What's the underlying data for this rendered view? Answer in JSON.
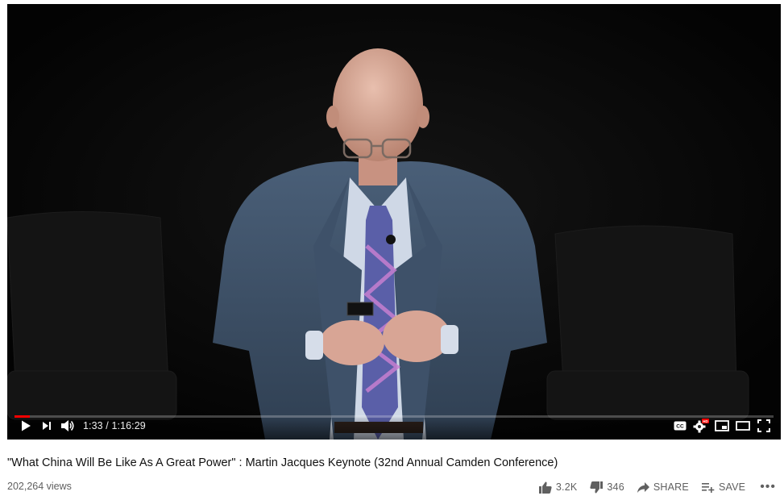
{
  "player": {
    "time": "1:33 / 1:16:29",
    "progress": 0.02,
    "progress_color": "#ff0000",
    "controls": [
      "play-icon",
      "next-icon",
      "volume-icon",
      "subtitles-icon",
      "settings-icon",
      "miniplayer-icon",
      "theater-icon",
      "fullscreen-icon"
    ],
    "settings_badge": "HD"
  },
  "video": {
    "title": "\"What China Will Be Like As A Great Power\" : Martin Jacques Keynote (32nd Annual Camden Conference)",
    "views": "202,264 views"
  },
  "actions": {
    "like_count": "3.2K",
    "dislike_count": "346",
    "share_label": "SHARE",
    "save_label": "SAVE",
    "more_label": "•••"
  }
}
